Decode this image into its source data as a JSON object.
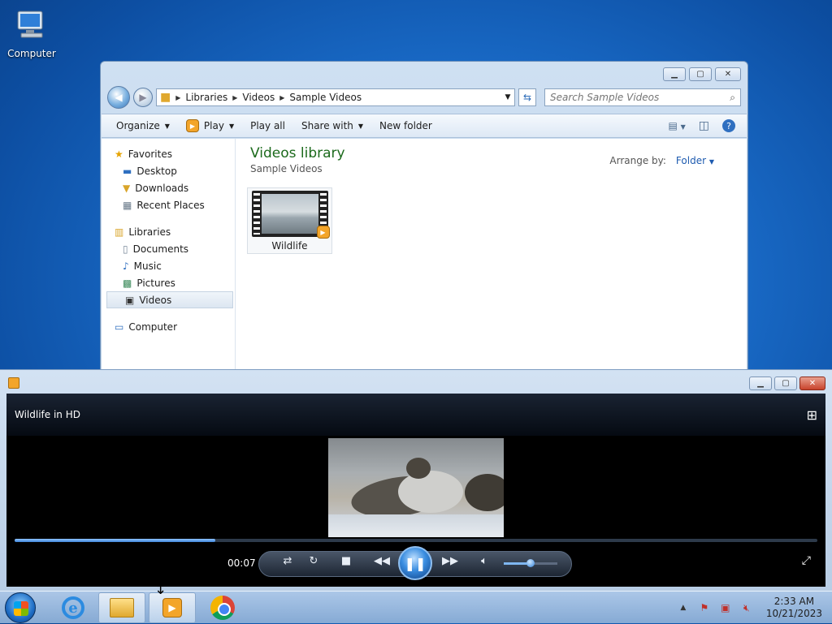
{
  "desktop": {
    "icon_label": "Computer"
  },
  "explorer": {
    "breadcrumb": [
      "Libraries",
      "Videos",
      "Sample Videos"
    ],
    "search_placeholder": "Search Sample Videos",
    "toolbar": {
      "organize": "Organize",
      "play": "Play",
      "play_all": "Play all",
      "share_with": "Share with",
      "new_folder": "New folder"
    },
    "nav": {
      "favorites": "Favorites",
      "favorites_items": [
        "Desktop",
        "Downloads",
        "Recent Places"
      ],
      "libraries": "Libraries",
      "libraries_items": [
        "Documents",
        "Music",
        "Pictures",
        "Videos"
      ],
      "computer": "Computer"
    },
    "library_title": "Videos library",
    "library_subtitle": "Sample Videos",
    "arrange_label": "Arrange by:",
    "arrange_value": "Folder",
    "file": {
      "name": "Wildlife"
    }
  },
  "player": {
    "title": "Wildlife in HD",
    "elapsed": "00:07",
    "progress_fraction": 0.25,
    "volume_fraction": 0.5
  },
  "taskbar": {
    "time": "2:33 AM",
    "date": "10/21/2023"
  },
  "colors": {
    "library_title": "#1c6a1c",
    "accent": "#1e5bb0"
  }
}
